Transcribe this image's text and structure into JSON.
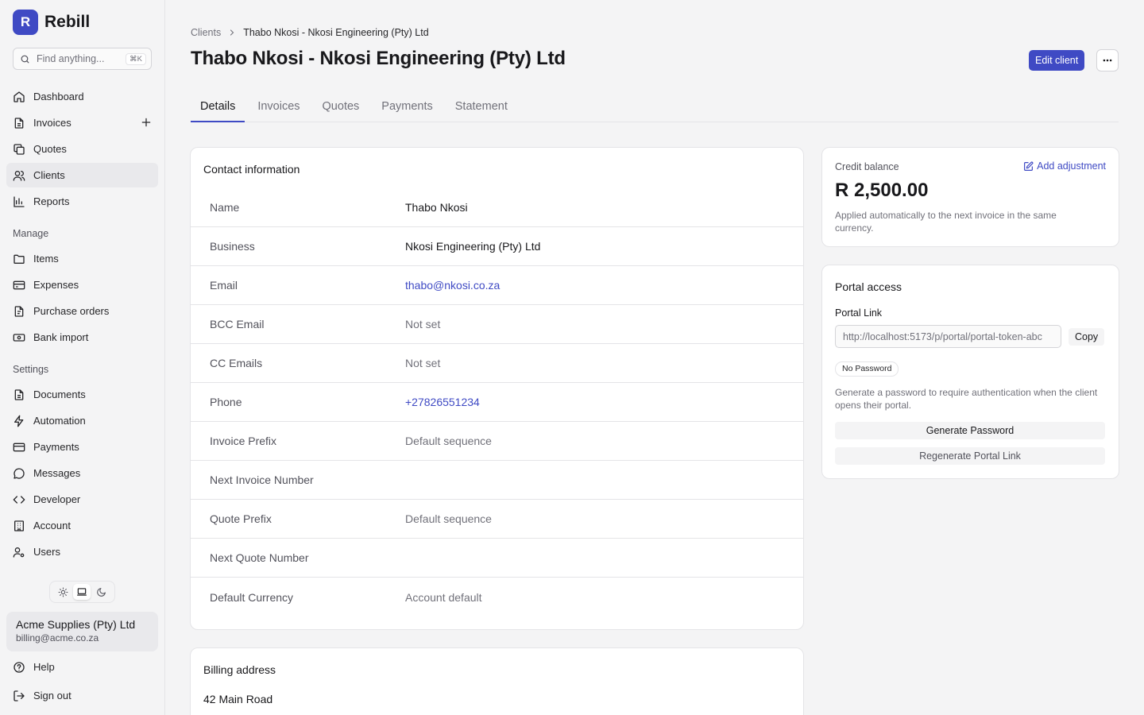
{
  "brand": {
    "logo_letter": "R",
    "name": "Rebill"
  },
  "search": {
    "placeholder": "Find anything...",
    "shortcut": "⌘K"
  },
  "sidebar": {
    "main_items": [
      {
        "label": "Dashboard"
      },
      {
        "label": "Invoices"
      },
      {
        "label": "Quotes"
      },
      {
        "label": "Clients"
      },
      {
        "label": "Reports"
      }
    ],
    "manage_label": "Manage",
    "manage_items": [
      {
        "label": "Items"
      },
      {
        "label": "Expenses"
      },
      {
        "label": "Purchase orders"
      },
      {
        "label": "Bank import"
      }
    ],
    "settings_label": "Settings",
    "settings_items": [
      {
        "label": "Documents"
      },
      {
        "label": "Automation"
      },
      {
        "label": "Payments"
      },
      {
        "label": "Messages"
      },
      {
        "label": "Developer"
      },
      {
        "label": "Account"
      },
      {
        "label": "Users"
      }
    ],
    "help_label": "Help",
    "signout_label": "Sign out"
  },
  "account": {
    "name": "Acme Supplies (Pty) Ltd",
    "email": "billing@acme.co.za"
  },
  "breadcrumb": {
    "parent": "Clients",
    "current": "Thabo Nkosi - Nkosi Engineering (Pty) Ltd"
  },
  "page": {
    "title": "Thabo Nkosi - Nkosi Engineering (Pty) Ltd",
    "edit_label": "Edit client"
  },
  "tabs": [
    {
      "label": "Details"
    },
    {
      "label": "Invoices"
    },
    {
      "label": "Quotes"
    },
    {
      "label": "Payments"
    },
    {
      "label": "Statement"
    }
  ],
  "contact": {
    "title": "Contact information",
    "rows": [
      {
        "label": "Name",
        "value": "Thabo Nkosi"
      },
      {
        "label": "Business",
        "value": "Nkosi Engineering (Pty) Ltd"
      },
      {
        "label": "Email",
        "value": "thabo@nkosi.co.za"
      },
      {
        "label": "BCC Email",
        "value": "Not set"
      },
      {
        "label": "CC Emails",
        "value": "Not set"
      },
      {
        "label": "Phone",
        "value": "+27826551234"
      },
      {
        "label": "Invoice Prefix",
        "value": "Default sequence"
      },
      {
        "label": "Next Invoice Number",
        "value": ""
      },
      {
        "label": "Quote Prefix",
        "value": "Default sequence"
      },
      {
        "label": "Next Quote Number",
        "value": ""
      },
      {
        "label": "Default Currency",
        "value": "Account default"
      }
    ]
  },
  "billing": {
    "title": "Billing address",
    "lines": [
      "42 Main Road"
    ]
  },
  "credit": {
    "label": "Credit balance",
    "add_label": "Add adjustment",
    "amount": "R 2,500.00",
    "note": "Applied automatically to the next invoice in the same currency."
  },
  "portal": {
    "title": "Portal access",
    "link_label": "Portal Link",
    "link_value": "http://localhost:5173/p/portal/portal-token-abc",
    "copy_label": "Copy",
    "badge": "No Password",
    "note": "Generate a password to require authentication when the client opens their portal.",
    "generate_label": "Generate Password",
    "regenerate_label": "Regenerate Portal Link"
  },
  "colors": {
    "accent": "#3f4ac4",
    "background": "#f4f4f5",
    "card": "#ffffff",
    "border": "#e4e4e7"
  }
}
